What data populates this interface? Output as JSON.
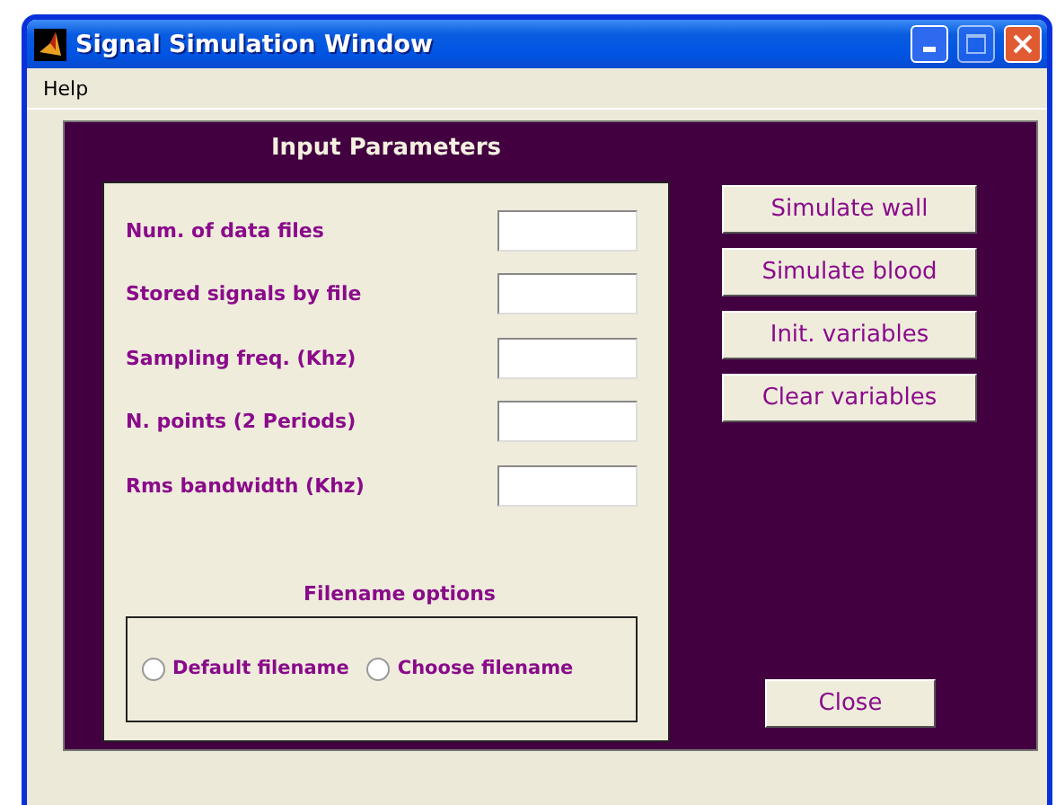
{
  "window": {
    "title": "Signal Simulation Window"
  },
  "menu": [
    "Help"
  ],
  "input_parameters": {
    "title": "Input Parameters",
    "fields": [
      {
        "label": "Num. of data files"
      },
      {
        "label": "Stored signals by file"
      },
      {
        "label": "Sampling freq. (Khz)"
      },
      {
        "label": "N. points (2 Periods)"
      },
      {
        "label": "Rms bandwidth (Khz)"
      }
    ]
  },
  "filename_options": {
    "title": "Filename options",
    "options": [
      {
        "label": "Default filename",
        "selected": false
      },
      {
        "label": "Choose filename",
        "selected": false
      }
    ]
  },
  "buttons": [
    "Simulate wall",
    "Simulate blood",
    "Init. variables",
    "Clear variables"
  ],
  "close_button": "Close"
}
